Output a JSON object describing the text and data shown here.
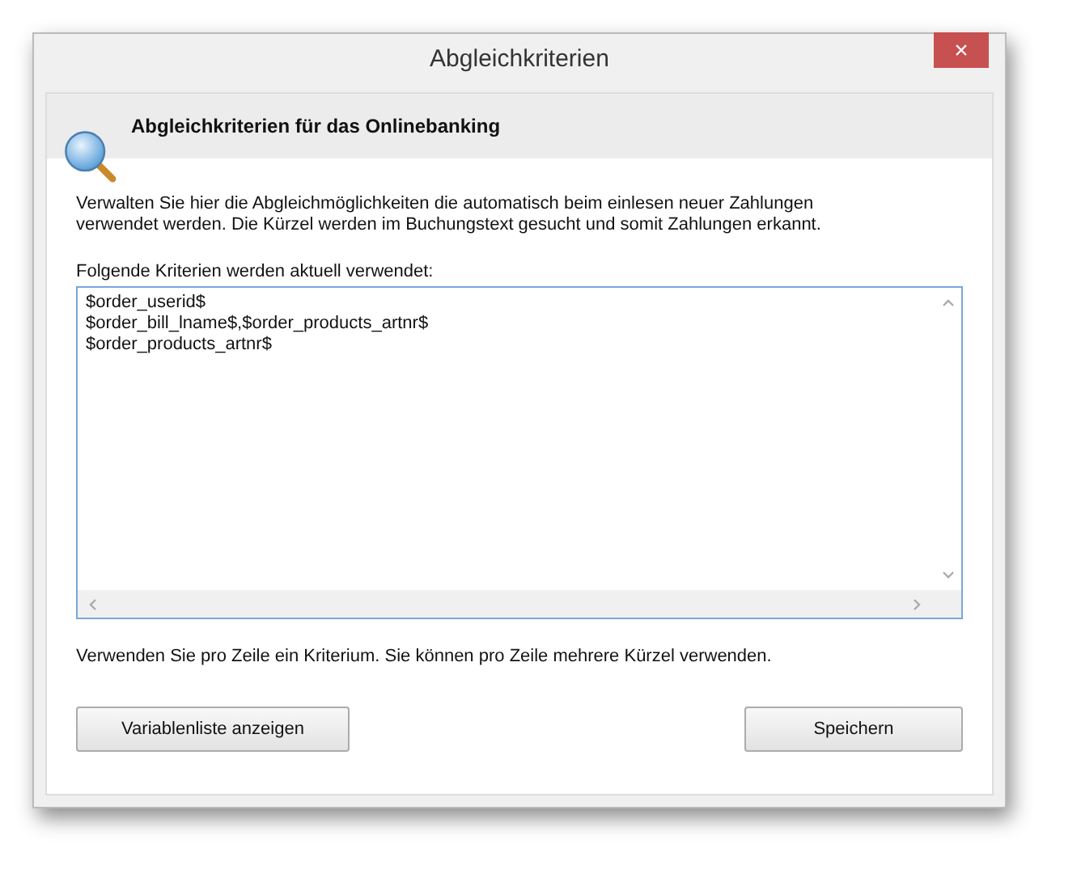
{
  "window": {
    "title": "Abgleichkriterien",
    "close": "×"
  },
  "header": {
    "title": "Abgleichkriterien für das Onlinebanking"
  },
  "description": "Verwalten Sie hier die Abgleichmöglichkeiten die automatisch beim einlesen neuer Zahlungen verwendet werden. Die Kürzel werden im Buchungstext gesucht und somit Zahlungen erkannt.",
  "criteria": {
    "label": "Folgende Kriterien werden aktuell verwendet:",
    "lines": [
      "$order_userid$",
      "$order_bill_lname$,$order_products_artnr$",
      "$order_products_artnr$"
    ]
  },
  "hint": "Verwenden Sie pro Zeile ein Kriterium. Sie können pro Zeile mehrere Kürzel verwenden.",
  "buttons": [
    {
      "label": "Variablenliste anzeigen",
      "kind": "left"
    },
    {
      "label": "Speichern",
      "kind": "right"
    }
  ]
}
